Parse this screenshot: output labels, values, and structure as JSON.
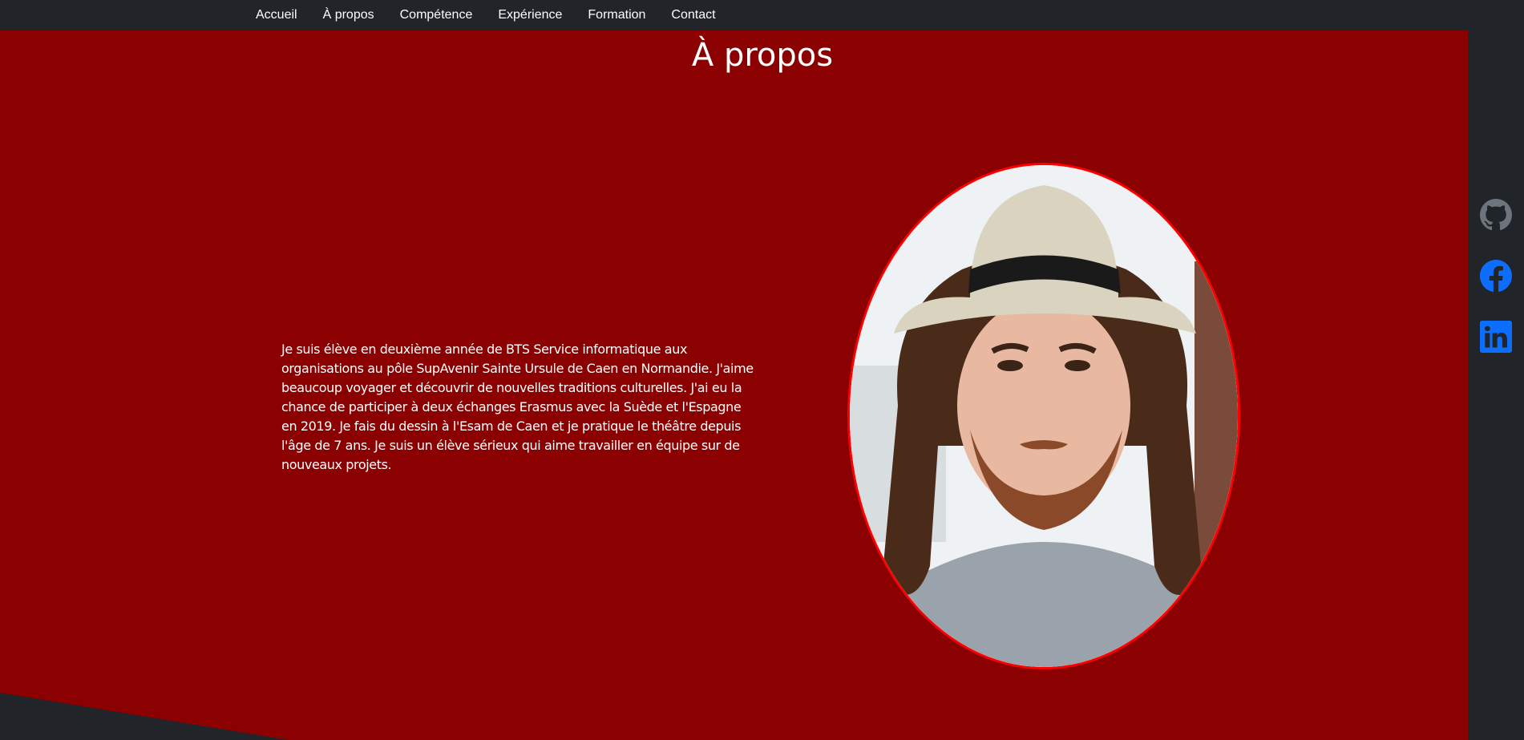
{
  "nav": {
    "items": [
      {
        "label": "Accueil"
      },
      {
        "label": "À propos"
      },
      {
        "label": "Compétence"
      },
      {
        "label": "Expérience"
      },
      {
        "label": "Formation"
      },
      {
        "label": "Contact"
      }
    ]
  },
  "about": {
    "title": "À propos",
    "text": "Je suis élève en deuxième année de BTS Service informatique aux organisations au pôle SupAvenir Sainte Ursule de Caen en Normandie. J'aime beaucoup voyager et découvrir de nouvelles traditions culturelles. J'ai eu la chance de participer à deux échanges Erasmus avec la Suède et l'Espagne en 2019. Je fais du dessin à l'Esam de Caen et je pratique le théâtre depuis l'âge de 7 ans. Je suis un élève sérieux qui aime travailler en équipe sur de nouveaux projets.",
    "portrait_icon": "portrait-photo"
  },
  "social": [
    {
      "icon": "github-icon",
      "color": "#6c757d"
    },
    {
      "icon": "facebook-icon",
      "color": "#0d6efd"
    },
    {
      "icon": "linkedin-icon",
      "color": "#0d6efd"
    }
  ],
  "colors": {
    "hero_bg": "#8b0000",
    "nav_bg": "#212529",
    "portrait_border": "#ff0000"
  }
}
